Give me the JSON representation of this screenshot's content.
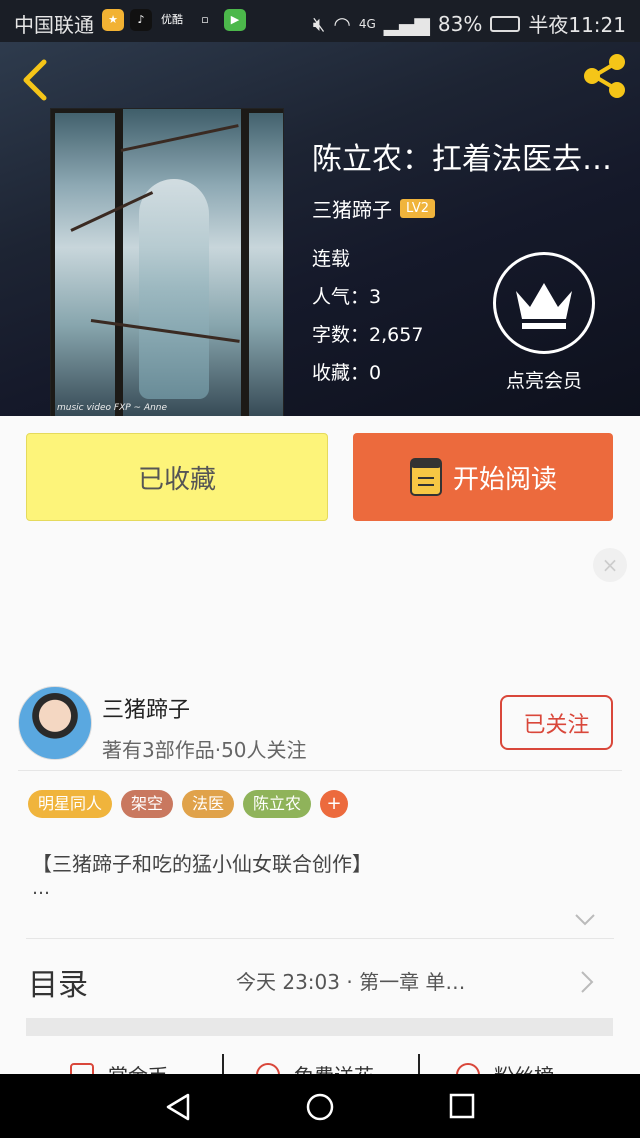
{
  "status_bar": {
    "carrier": "中国联通",
    "app_icon_text": "优酷",
    "network": "4G",
    "battery": "83%",
    "time": "半夜11:21"
  },
  "header": {
    "title": "陈立农：扛着法医去…",
    "author": "三猪蹄子",
    "level_badge": "LV2",
    "status": "连载",
    "popularity_label": "人气：",
    "popularity_value": "3",
    "word_count_label": "字数：",
    "word_count_value": "2,657",
    "favorites_label": "收藏：",
    "favorites_value": "0",
    "vip_label": "点亮会员",
    "cover_signature": "music video FXP ~ Anne"
  },
  "actions": {
    "favorited_label": "已收藏",
    "read_label": "开始阅读"
  },
  "author_card": {
    "name": "三猪蹄子",
    "stats": "著有3部作品·50人关注",
    "follow_label": "已关注"
  },
  "tags": [
    {
      "label": "明星同人",
      "color": "#f0b43c"
    },
    {
      "label": "架空",
      "color": "#c9785f"
    },
    {
      "label": "法医",
      "color": "#e0a24a"
    },
    {
      "label": "陈立农",
      "color": "#8fb35a"
    }
  ],
  "tag_add": "+",
  "description": {
    "text": "【三猪蹄子和吃的猛小仙女联合创作】",
    "more": "…"
  },
  "toc": {
    "label": "目录",
    "latest": "今天 23:03 · 第一章 单…"
  },
  "bottom_actions": [
    {
      "label": "赏金币"
    },
    {
      "label": "免费送花"
    },
    {
      "label": "粉丝榜"
    }
  ],
  "colors": {
    "accent": "#ec6a3d",
    "favorite_button": "#fdf47a",
    "follow": "#d9473a",
    "back_icon": "#f5c518"
  }
}
